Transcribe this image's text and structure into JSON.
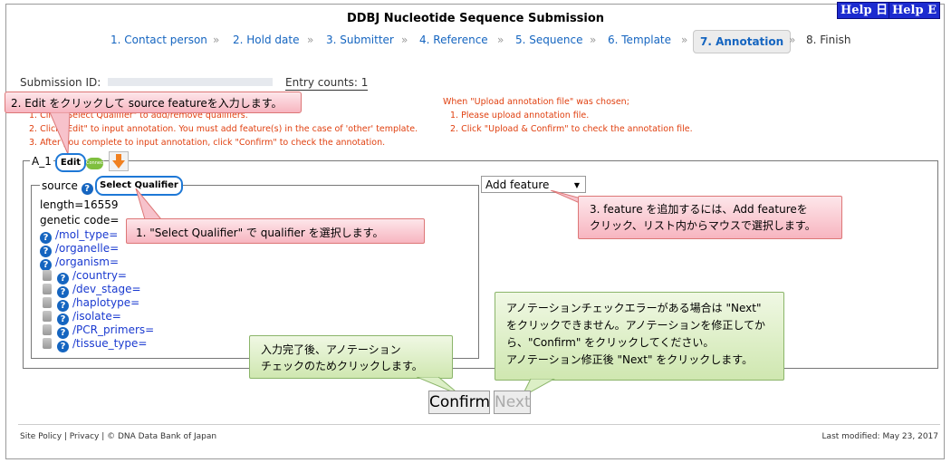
{
  "page_title": "DDBJ Nucleotide Sequence Submission",
  "help": [
    "Help 日",
    "Help E"
  ],
  "nav": {
    "steps": [
      "1. Contact person",
      "2. Hold date",
      "3. Submitter",
      "4. Reference",
      "5. Sequence",
      "6. Template",
      "7. Annotation",
      "8. Finish"
    ],
    "separator": "»"
  },
  "submission": {
    "id_label": "Submission ID:",
    "entry_counts": "Entry counts: 1"
  },
  "instructions_left": [
    "1. Click \"Select Qualifier\" to add/remove qualifiers.",
    "2. Click \"Edit\" to input annotation. You must add feature(s) in the case of 'other' template.",
    "3. After you complete to input annotation, click \"Confirm\" to check the annotation."
  ],
  "instructions_right": {
    "heading": "When \"Upload annotation file\" was chosen;",
    "items": [
      "1. Please upload annotation file.",
      "2. Click \"Upload & Confirm\" to check the annotation file."
    ]
  },
  "entry_block": {
    "label": "A_1",
    "edit_label": "Edit",
    "connect_label": "Connect"
  },
  "feature": {
    "source_label": "source",
    "select_qualifier": "Select Qualifier",
    "add_feature": "Add feature",
    "length": "length=16559",
    "genetic_code": "genetic code=",
    "required_qualifiers": [
      "/mol_type=",
      "/organelle=",
      "/organism="
    ],
    "optional_qualifiers": [
      "/country=",
      "/dev_stage=",
      "/haplotype=",
      "/isolate=",
      "/PCR_primers=",
      "/tissue_type="
    ]
  },
  "callouts": {
    "edit": "2. Edit をクリックして source featureを入力します。",
    "select_qualifier": "1. \"Select Qualifier\" で qualifier を選択します。",
    "add_feature": [
      "3. feature を追加するには、Add featureを",
      "クリック、リスト内からマウスで選択します。"
    ],
    "confirm": [
      "入力完了後、アノテーション",
      "チェックのためクリックします。"
    ],
    "next": [
      "アノテーションチェックエラーがある場合は \"Next\"",
      "をクリックできません。アノテーションを修正してか",
      "ら、\"Confirm\" をクリックしてください。",
      "アノテーション修正後 \"Next\" をクリックします。"
    ]
  },
  "buttons": {
    "confirm": "Confirm",
    "next": "Next"
  },
  "footer": {
    "left": "Site Policy | Privacy | © DNA Data Bank of Japan",
    "right": "Last modified: May 23, 2017"
  }
}
